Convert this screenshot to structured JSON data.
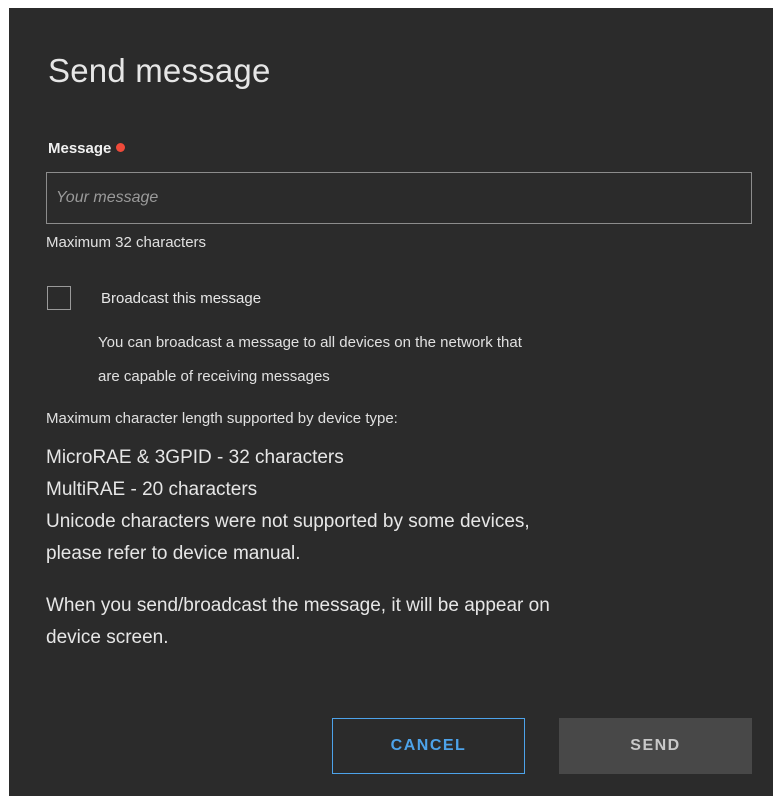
{
  "dialog": {
    "title": "Send message",
    "message_field": {
      "label": "Message",
      "placeholder": "Your message",
      "value": "",
      "hint": "Maximum 32 characters",
      "required_color": "#ef4a3a"
    },
    "broadcast": {
      "checked": false,
      "label": "Broadcast this message",
      "description_line1": "You can broadcast a message to all devices on the network that",
      "description_line2": "are capable of receiving messages"
    },
    "limits": {
      "heading": "Maximum character length supported by device type:",
      "line1": "MicroRAE & 3GPID - 32 characters",
      "line2": "MultiRAE - 20 characters",
      "line3": "Unicode characters were not supported by some devices,",
      "line4": "please refer to device manual."
    },
    "note_line1": "When you send/broadcast the message, it will be appear on",
    "note_line2": "device screen.",
    "buttons": {
      "cancel_label": "CANCEL",
      "send_label": "SEND"
    },
    "colors": {
      "background": "#2b2b2b",
      "accent": "#4da3ea",
      "disabled_button": "#484848"
    }
  }
}
